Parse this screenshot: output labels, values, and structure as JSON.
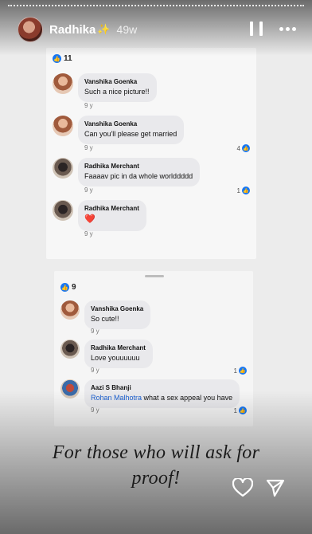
{
  "story": {
    "username": "Radhika",
    "verified_icon": "sparkle-badge-icon",
    "posted_ago": "49w"
  },
  "panel1": {
    "reaction_count": "11",
    "comments": [
      {
        "author": "Vanshika Goenka",
        "text": "Such a nice picture!!",
        "age": "9 y",
        "likes": ""
      },
      {
        "author": "Vanshika Goenka",
        "text": "Can you'll please get married",
        "age": "9 y",
        "likes": "4"
      },
      {
        "author": "Radhika Merchant",
        "text": "Faaaav pic in da whole worlddddd",
        "age": "9 y",
        "likes": "1"
      },
      {
        "author": "Radhika Merchant",
        "text": "❤️",
        "age": "9 y",
        "likes": ""
      }
    ]
  },
  "panel2": {
    "reaction_count": "9",
    "comments": [
      {
        "author": "Vanshika Goenka",
        "text": "So cute!!",
        "age": "9 y",
        "likes": ""
      },
      {
        "author": "Radhika Merchant",
        "text": "Love youuuuuu",
        "age": "9 y",
        "likes": "1"
      },
      {
        "author": "Aazi S Bhanji",
        "mention": "Rohan Malhotra",
        "text": " what a sex appeal you have",
        "age": "9 y",
        "likes": "1"
      }
    ]
  },
  "caption": {
    "line1": "For those who will ask for",
    "line2": "proof!"
  },
  "colors": {
    "like_blue": "#1877f2",
    "mention_blue": "#1a5fd0",
    "bubble_gray": "#e9e9ec"
  }
}
